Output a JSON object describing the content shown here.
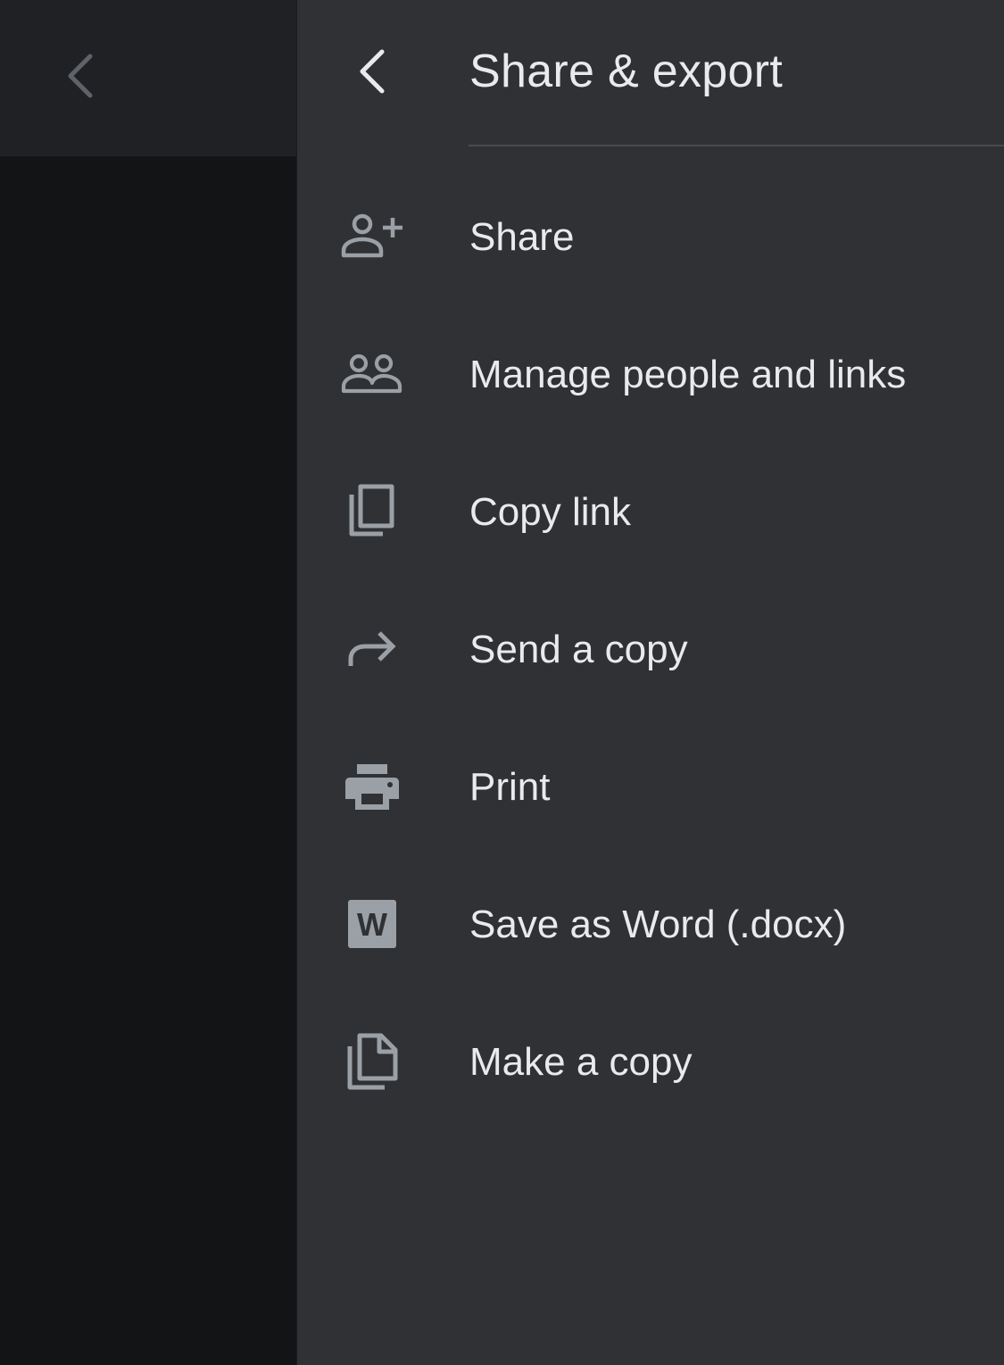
{
  "panel": {
    "title": "Share & export"
  },
  "menu": {
    "items": [
      {
        "label": "Share",
        "icon": "person-add-icon"
      },
      {
        "label": "Manage people and links",
        "icon": "people-icon"
      },
      {
        "label": "Copy link",
        "icon": "copy-link-icon"
      },
      {
        "label": "Send a copy",
        "icon": "forward-arrow-icon"
      },
      {
        "label": "Print",
        "icon": "printer-icon"
      },
      {
        "label": "Save as Word (.docx)",
        "icon": "word-icon"
      },
      {
        "label": "Make a copy",
        "icon": "file-copy-icon"
      }
    ]
  },
  "icons": {
    "word_letter": "W"
  },
  "colors": {
    "sheet_background": "#303134",
    "page_background": "#131416",
    "topbar_background": "#202124",
    "text_primary": "#e8eaed",
    "icon_gray": "#9aa0a6",
    "back_dim": "#5f6368"
  }
}
